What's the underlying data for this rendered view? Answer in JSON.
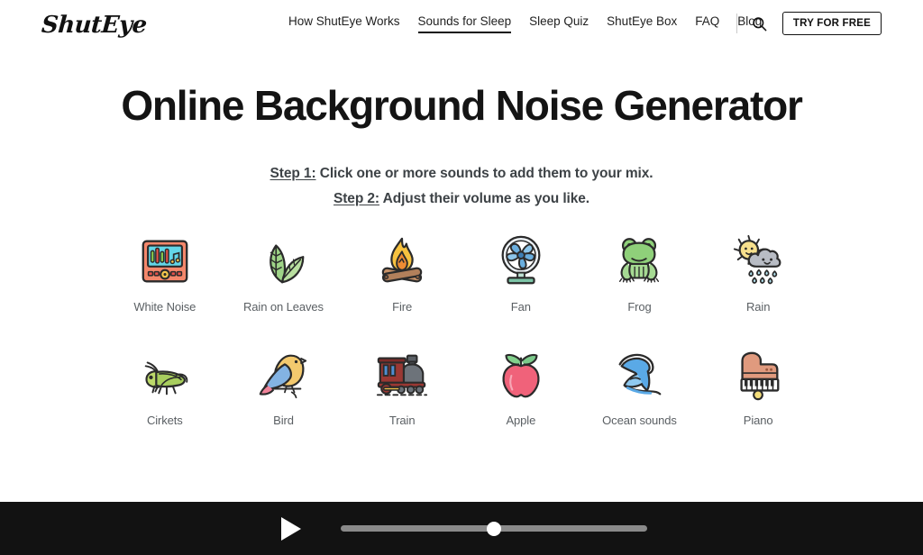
{
  "brand": {
    "logo_text": "ShutEye"
  },
  "nav": {
    "items": [
      {
        "label": "How ShutEye Works",
        "active": false
      },
      {
        "label": "Sounds for Sleep",
        "active": true
      },
      {
        "label": "Sleep Quiz",
        "active": false
      },
      {
        "label": "ShutEye Box",
        "active": false
      },
      {
        "label": "FAQ",
        "active": false
      },
      {
        "label": "Blog",
        "active": false
      }
    ],
    "search_icon": "search-icon",
    "cta_label": "TRY FOR FREE"
  },
  "hero": {
    "title": "Online Background Noise Generator",
    "step1_label": "Step 1:",
    "step1_text": " Click one or more sounds to add them to your mix.",
    "step2_label": "Step 2:",
    "step2_text": " Adjust their volume as you like."
  },
  "sounds": [
    {
      "label": "White Noise",
      "icon": "white-noise-icon"
    },
    {
      "label": "Rain on Leaves",
      "icon": "leaves-icon"
    },
    {
      "label": "Fire",
      "icon": "campfire-icon"
    },
    {
      "label": "Fan",
      "icon": "fan-icon"
    },
    {
      "label": "Frog",
      "icon": "frog-icon"
    },
    {
      "label": "Rain",
      "icon": "rain-cloud-sun-icon"
    },
    {
      "label": "Cirkets",
      "icon": "cricket-icon"
    },
    {
      "label": "Bird",
      "icon": "bird-icon"
    },
    {
      "label": "Train",
      "icon": "train-icon"
    },
    {
      "label": "Apple",
      "icon": "apple-icon"
    },
    {
      "label": "Ocean sounds",
      "icon": "wave-icon"
    },
    {
      "label": "Piano",
      "icon": "piano-icon"
    }
  ],
  "player": {
    "play_icon": "play-icon",
    "volume_percent": 50
  },
  "colors": {
    "page_bg": "#ffffff",
    "text": "#1a1a1a",
    "label_gray": "#5a5f63",
    "player_bg": "#121212",
    "slider_track": "#8a8a8a",
    "slider_thumb": "#ffffff"
  }
}
